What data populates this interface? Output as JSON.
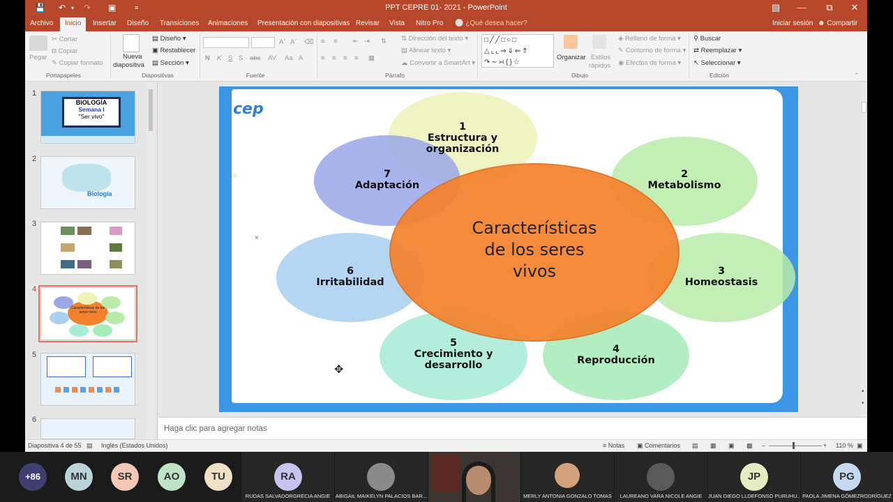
{
  "window": {
    "title": "PPT CEPRE 01- 2021 - PowerPoint"
  },
  "tabs": [
    "Archivo",
    "Inicio",
    "Insertar",
    "Diseño",
    "Transiciones",
    "Animaciones",
    "Presentación con diapositivas",
    "Revisar",
    "Vista",
    "Nitro Pro"
  ],
  "tell_me": "¿Qué desea hacer?",
  "signin": "Iniciar sesión",
  "share": "Compartir",
  "ribbon": {
    "clipboard": {
      "paste": "Pegar",
      "cut": "Cortar",
      "copy": "Copiar",
      "format_painter": "Copiar formato",
      "group": "Portapapeles"
    },
    "slides": {
      "new_slide_1": "Nueva",
      "new_slide_2": "diapositiva",
      "layout": "Diseño",
      "reset": "Restablecer",
      "section": "Sección",
      "group": "Diapositivas"
    },
    "font": {
      "bold": "N",
      "italic": "K",
      "underline": "S",
      "strike": "abc",
      "spacing": "AV",
      "case": "Aa",
      "group": "Fuente"
    },
    "paragraph": {
      "text_direction": "Dirección del texto",
      "align_text": "Alinear texto",
      "smartart": "Convertir a SmartArt",
      "group": "Párrafo"
    },
    "drawing": {
      "arrange": "Organizar",
      "quick_styles_1": "Estilos",
      "quick_styles_2": "rápidos",
      "fill": "Relleno de forma",
      "outline": "Contorno de forma",
      "effects": "Efectos de forma",
      "group": "Dibujo"
    },
    "editing": {
      "find": "Buscar",
      "replace": "Reemplazar",
      "select": "Seleccionar",
      "group": "Edición"
    }
  },
  "thumbnails": [
    {
      "number": "1",
      "title": "BIOLOGÍA",
      "subtitle": "Semana I",
      "caption": "\"Ser vivo\""
    },
    {
      "number": "2",
      "caption": "Biología"
    },
    {
      "number": "3"
    },
    {
      "number": "4",
      "caption": "Características de los seres vivos"
    },
    {
      "number": "5"
    },
    {
      "number": "6"
    }
  ],
  "slide": {
    "logo": "cep",
    "center": [
      "Características",
      "de los seres",
      "vivos"
    ],
    "items": [
      {
        "n": "1",
        "label": "Estructura y organización",
        "color": "#eef3b8"
      },
      {
        "n": "2",
        "label": "Metabolismo",
        "color": "#b9ecaa"
      },
      {
        "n": "3",
        "label": "Homeostasis",
        "color": "#b9ecaa"
      },
      {
        "n": "4",
        "label": "Reproducción",
        "color": "#a5ecb8"
      },
      {
        "n": "5",
        "label": "Crecimiento y desarrollo",
        "color": "#a6ecd8"
      },
      {
        "n": "6",
        "label": "Irritabilidad",
        "color": "#a8d0f0"
      },
      {
        "n": "7",
        "label": "Adaptación",
        "color": "#9aa8e8"
      }
    ],
    "center_color": "#f4822c"
  },
  "notes_placeholder": "Haga clic para agregar notas",
  "status": {
    "slide_info": "Diapositiva 4 de 55",
    "language": "Inglés (Estados Unidos)",
    "notes": "Notas",
    "comments": "Comentarios",
    "zoom": "110 %"
  },
  "participants": {
    "more": "+86",
    "avatars": [
      {
        "initials": "MN",
        "color": "#b9d3d9"
      },
      {
        "initials": "SR",
        "color": "#f3c8b4"
      },
      {
        "initials": "AO",
        "color": "#bfe3c6"
      },
      {
        "initials": "TU",
        "color": "#efe0c6"
      }
    ],
    "tiles": [
      {
        "initials": "RA",
        "name": "RUDAS SALVADORGRECIA ANGIE",
        "color": "#c6c3ef"
      },
      {
        "name": "ABIGAIL MAIKELYN PALACIOS BAR..."
      },
      {
        "name": "MERLY ANTONIA GONZALO TOMAS"
      },
      {
        "name": "LAUREANO VARA NICOLE ANGIE"
      },
      {
        "initials": "JP",
        "name": "JUAN DIEGO LLDEFONSO PURUHU...",
        "color": "#e6ecc0"
      },
      {
        "initials": "PG",
        "name": "PAOLA JIMENA GÓMEZRODRÍGUEZ",
        "color": "#c6d9f0"
      }
    ]
  }
}
